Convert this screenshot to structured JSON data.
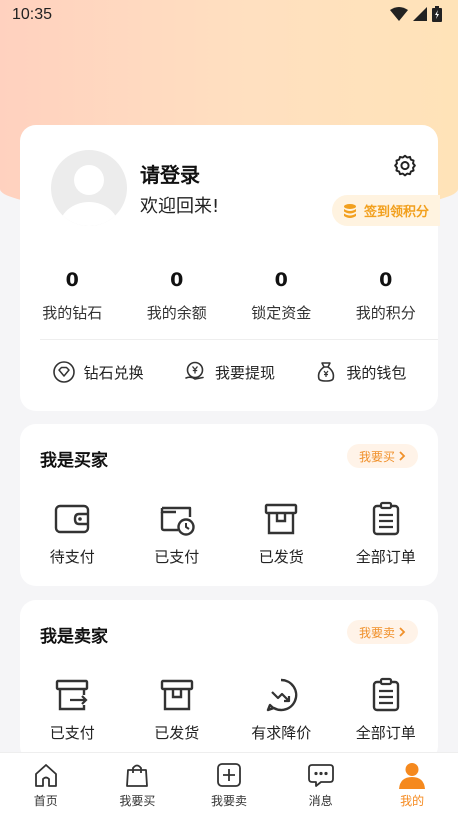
{
  "status_bar": {
    "time": "10:35"
  },
  "profile": {
    "login_text": "请登录",
    "welcome_text": "欢迎回来!",
    "signin_label": "签到领积分",
    "stats": [
      {
        "value": "0",
        "label": "我的钻石"
      },
      {
        "value": "0",
        "label": "我的余额"
      },
      {
        "value": "0",
        "label": "锁定资金"
      },
      {
        "value": "0",
        "label": "我的积分"
      }
    ],
    "actions": [
      {
        "label": "钻石兑换",
        "icon": "diamond-exchange-icon"
      },
      {
        "label": "我要提现",
        "icon": "withdraw-icon"
      },
      {
        "label": "我的钱包",
        "icon": "wallet-bag-icon"
      }
    ]
  },
  "buyer": {
    "title": "我是买家",
    "pill_label": "我要买",
    "items": [
      {
        "label": "待支付",
        "icon": "wallet-icon"
      },
      {
        "label": "已支付",
        "icon": "paid-clock-icon"
      },
      {
        "label": "已发货",
        "icon": "box-icon"
      },
      {
        "label": "全部订单",
        "icon": "clipboard-icon"
      }
    ]
  },
  "seller": {
    "title": "我是卖家",
    "pill_label": "我要卖",
    "items": [
      {
        "label": "已支付",
        "icon": "box-export-icon"
      },
      {
        "label": "已发货",
        "icon": "box-icon"
      },
      {
        "label": "有求降价",
        "icon": "price-drop-icon"
      },
      {
        "label": "全部订单",
        "icon": "clipboard-icon"
      }
    ]
  },
  "tabbar": {
    "items": [
      {
        "label": "首页",
        "icon": "home-icon"
      },
      {
        "label": "我要买",
        "icon": "shopping-bag-icon"
      },
      {
        "label": "我要卖",
        "icon": "plus-square-icon"
      },
      {
        "label": "消息",
        "icon": "chat-icon"
      },
      {
        "label": "我的",
        "icon": "user-icon"
      }
    ],
    "active": "我的",
    "active_color": "#f5891e"
  },
  "colors": {
    "accent": "#f5891e",
    "signin_text": "#f2a01e",
    "header_gradient_start": "#ffd1bf",
    "header_gradient_end": "#ffe3b8"
  }
}
